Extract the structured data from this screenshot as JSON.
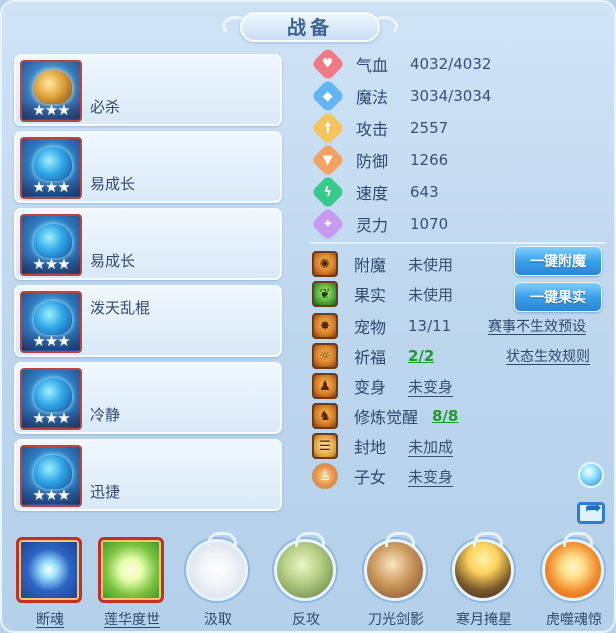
{
  "title": "战备",
  "pets": [
    {
      "label": "必杀",
      "stars": "★★★",
      "portrait_icon": "golden-deer-pet-icon"
    },
    {
      "label": "易成长",
      "stars": "★★★",
      "portrait_icon": "blue-beast-pet-icon"
    },
    {
      "label": "易成长",
      "stars": "★★★",
      "portrait_icon": "blue-dragon-pet-icon"
    },
    {
      "label": "泼天乱棍",
      "stars": "★★★",
      "portrait_icon": "blue-serpent-pet-icon"
    },
    {
      "label": "冷静",
      "stars": "★★★",
      "portrait_icon": "blue-helmet-pet-icon"
    },
    {
      "label": "迅捷",
      "stars": "★★★",
      "portrait_icon": "blue-armor-pet-icon"
    }
  ],
  "stats": [
    {
      "name": "气血",
      "value": "4032/4032",
      "icon": "heart-icon",
      "color": "#f07a83"
    },
    {
      "name": "魔法",
      "value": "3034/3034",
      "icon": "mana-icon",
      "color": "#62b5f3"
    },
    {
      "name": "攻击",
      "value": "2557",
      "icon": "sword-icon",
      "color": "#f6c35c"
    },
    {
      "name": "防御",
      "value": "1266",
      "icon": "shield-icon",
      "color": "#f3a262"
    },
    {
      "name": "速度",
      "value": "643",
      "icon": "lightning-icon",
      "color": "#37c98b"
    },
    {
      "name": "灵力",
      "value": "1070",
      "icon": "spirit-icon",
      "color": "#c79af0"
    }
  ],
  "info": {
    "enchant": {
      "name": "附魔",
      "value": "未使用"
    },
    "fruit": {
      "name": "果实",
      "value": "未使用"
    },
    "pet": {
      "name": "宠物",
      "value": "13/11"
    },
    "blessing": {
      "name": "祈福",
      "value": "2/2"
    },
    "transform": {
      "name": "变身",
      "value": "未变身"
    },
    "awaken": {
      "name": "修炼觉醒",
      "value": "8/8"
    },
    "seal": {
      "name": "封地",
      "value": "未加成"
    },
    "child": {
      "name": "子女",
      "value": "未变身"
    }
  },
  "buttons": {
    "enchant": "一键附魔",
    "fruit": "一键果实"
  },
  "links": {
    "preset": "赛事不生效预设",
    "rules": "状态生效规则"
  },
  "skills": [
    {
      "label": "断魂",
      "style": "square",
      "icon": "blue-orb-skill-icon",
      "c1": "#9fe3ff",
      "c2": "#1d3f8f"
    },
    {
      "label": "莲华度世",
      "style": "square",
      "icon": "lotus-hand-skill-icon",
      "c1": "#e9ffb0",
      "c2": "#3b8f2a"
    },
    {
      "label": "汲取",
      "style": "circle",
      "icon": "drain-skill-icon",
      "c1": "#ffffff",
      "c2": "#cfd9e6"
    },
    {
      "label": "反攻",
      "style": "circle",
      "icon": "counter-skill-icon",
      "c1": "#d7e6a6",
      "c2": "#5e7a3a"
    },
    {
      "label": "刀光剑影",
      "style": "circle",
      "icon": "blade-skill-icon",
      "c1": "#f2d6a8",
      "c2": "#7a4a2a"
    },
    {
      "label": "寒月掩星",
      "style": "circle",
      "icon": "moon-skill-icon",
      "c1": "#ffd35c",
      "c2": "#3a2a1a"
    },
    {
      "label": "虎噬魂惊",
      "style": "circle",
      "icon": "tiger-skill-icon",
      "c1": "#ffe08a",
      "c2": "#d0541c"
    }
  ]
}
